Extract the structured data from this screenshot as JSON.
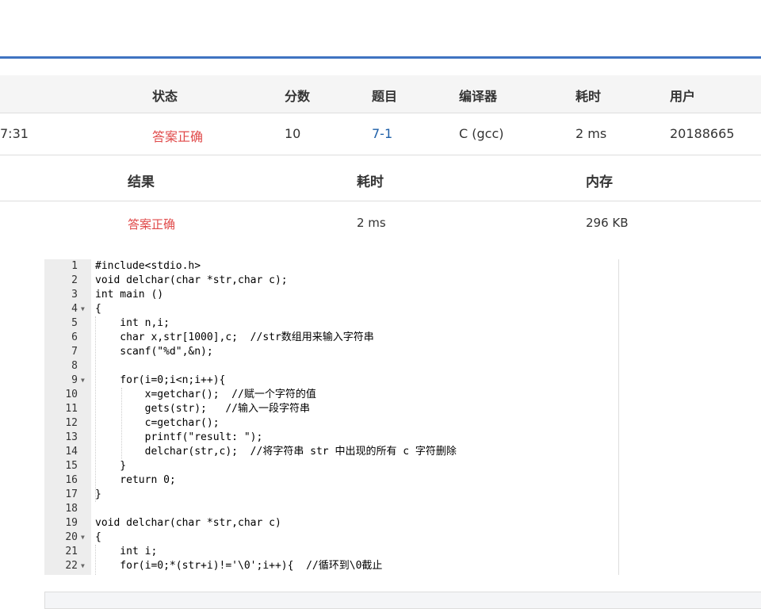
{
  "submission": {
    "headers": [
      "状态",
      "分数",
      "题目",
      "编译器",
      "耗时",
      "用户"
    ],
    "row": {
      "time_fragment": "7:31",
      "status": "答案正确",
      "score": "10",
      "problem": "7-1",
      "compiler": "C (gcc)",
      "time": "2 ms",
      "user": "20188665"
    }
  },
  "result": {
    "headers": [
      "结果",
      "耗时",
      "内存"
    ],
    "row": {
      "result": "答案正确",
      "time": "2 ms",
      "memory": "296 KB"
    }
  },
  "code": {
    "lines": [
      {
        "n": "1",
        "fold": "",
        "text": "#include<stdio.h>"
      },
      {
        "n": "2",
        "fold": "",
        "text": "void delchar(char *str,char c);"
      },
      {
        "n": "3",
        "fold": "",
        "text": "int main ()"
      },
      {
        "n": "4",
        "fold": "▼",
        "text": "{"
      },
      {
        "n": "5",
        "fold": "",
        "text": "    int n,i;"
      },
      {
        "n": "6",
        "fold": "",
        "text": "    char x,str[1000],c;  //str数组用来输入字符串"
      },
      {
        "n": "7",
        "fold": "",
        "text": "    scanf(\"%d\",&n);"
      },
      {
        "n": "8",
        "fold": "",
        "text": ""
      },
      {
        "n": "9",
        "fold": "▼",
        "text": "    for(i=0;i<n;i++){"
      },
      {
        "n": "10",
        "fold": "",
        "text": "        x=getchar();  //赋一个字符的值"
      },
      {
        "n": "11",
        "fold": "",
        "text": "        gets(str);   //输入一段字符串"
      },
      {
        "n": "12",
        "fold": "",
        "text": "        c=getchar();"
      },
      {
        "n": "13",
        "fold": "",
        "text": "        printf(\"result: \");"
      },
      {
        "n": "14",
        "fold": "",
        "text": "        delchar(str,c);  //将字符串 str 中出现的所有 c 字符删除"
      },
      {
        "n": "15",
        "fold": "",
        "text": "    }"
      },
      {
        "n": "16",
        "fold": "",
        "text": "    return 0;"
      },
      {
        "n": "17",
        "fold": "",
        "text": "}"
      },
      {
        "n": "18",
        "fold": "",
        "text": ""
      },
      {
        "n": "19",
        "fold": "",
        "text": "void delchar(char *str,char c)"
      },
      {
        "n": "20",
        "fold": "▼",
        "text": "{"
      },
      {
        "n": "21",
        "fold": "",
        "text": "    int i;"
      },
      {
        "n": "22",
        "fold": "▼",
        "text": "    for(i=0;*(str+i)!='\\0';i++){  //循环到\\0截止"
      }
    ]
  }
}
